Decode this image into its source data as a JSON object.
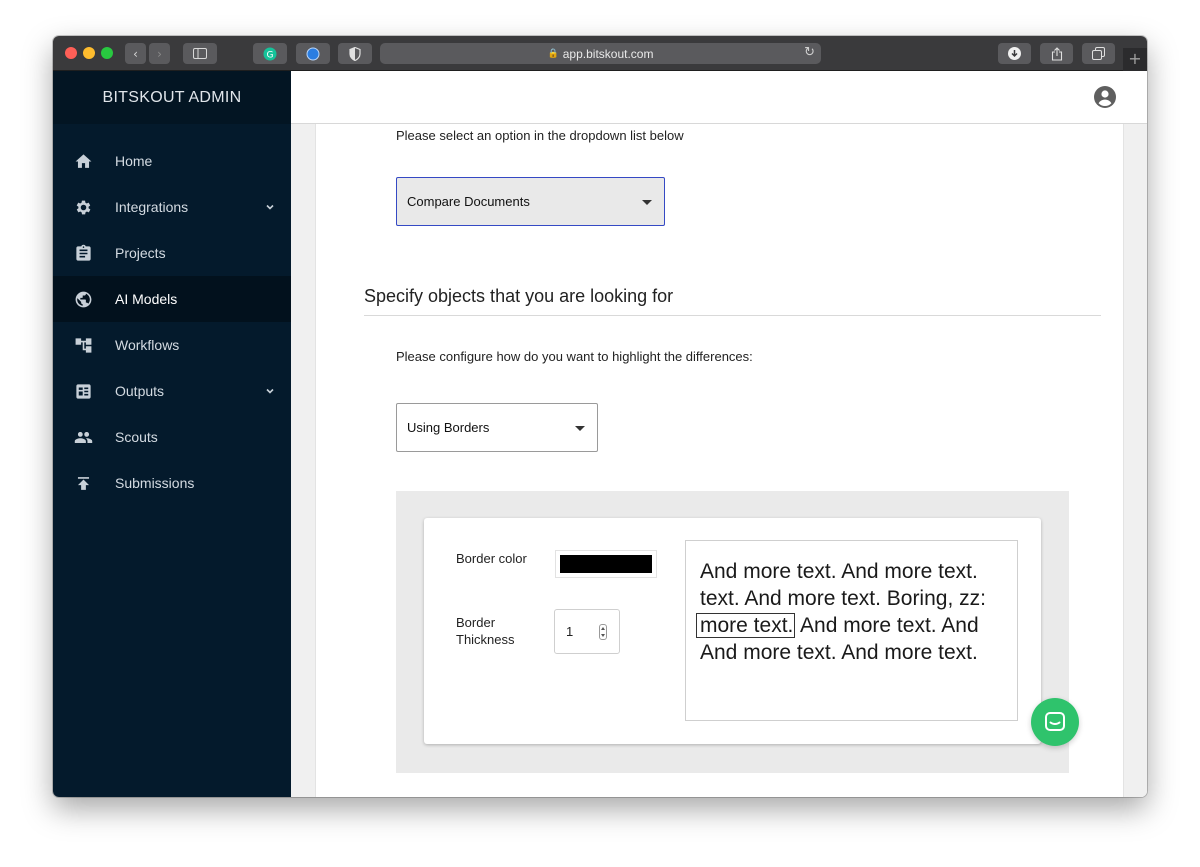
{
  "browser": {
    "url": "app.bitskout.com"
  },
  "app": {
    "brand": "BITSKOUT ADMIN"
  },
  "sidebar": {
    "items": [
      {
        "label": "Home",
        "icon": "home-icon"
      },
      {
        "label": "Integrations",
        "icon": "gear-icon",
        "expandable": true
      },
      {
        "label": "Projects",
        "icon": "clipboard-icon"
      },
      {
        "label": "AI Models",
        "icon": "globe-icon",
        "active": true
      },
      {
        "label": "Workflows",
        "icon": "workflow-icon"
      },
      {
        "label": "Outputs",
        "icon": "dashboard-icon",
        "expandable": true
      },
      {
        "label": "Scouts",
        "icon": "people-icon"
      },
      {
        "label": "Submissions",
        "icon": "upload-icon"
      }
    ]
  },
  "main": {
    "select_hint": "Please select an option in the dropdown list below",
    "model_select_value": "Compare Documents",
    "section_title": "Specify objects that you are looking for",
    "highlight_hint": "Please configure how do you want to highlight the differences:",
    "highlight_select_value": "Using Borders",
    "border_color_label": "Border color",
    "border_color_value": "#000000",
    "border_thickness_label": "Border Thickness",
    "border_thickness_value": "1",
    "sample_text": {
      "line1": "And more text. And more text.",
      "line2": "text. And more text. Boring, zz:",
      "line3_boxed": "more text.",
      "line3_rest": " And more text. And",
      "line4": "And more text. And more text."
    }
  },
  "colors": {
    "sidebar_bg": "#041a2c",
    "selected_border": "#3549c4",
    "chat_button": "#2fc36c"
  }
}
